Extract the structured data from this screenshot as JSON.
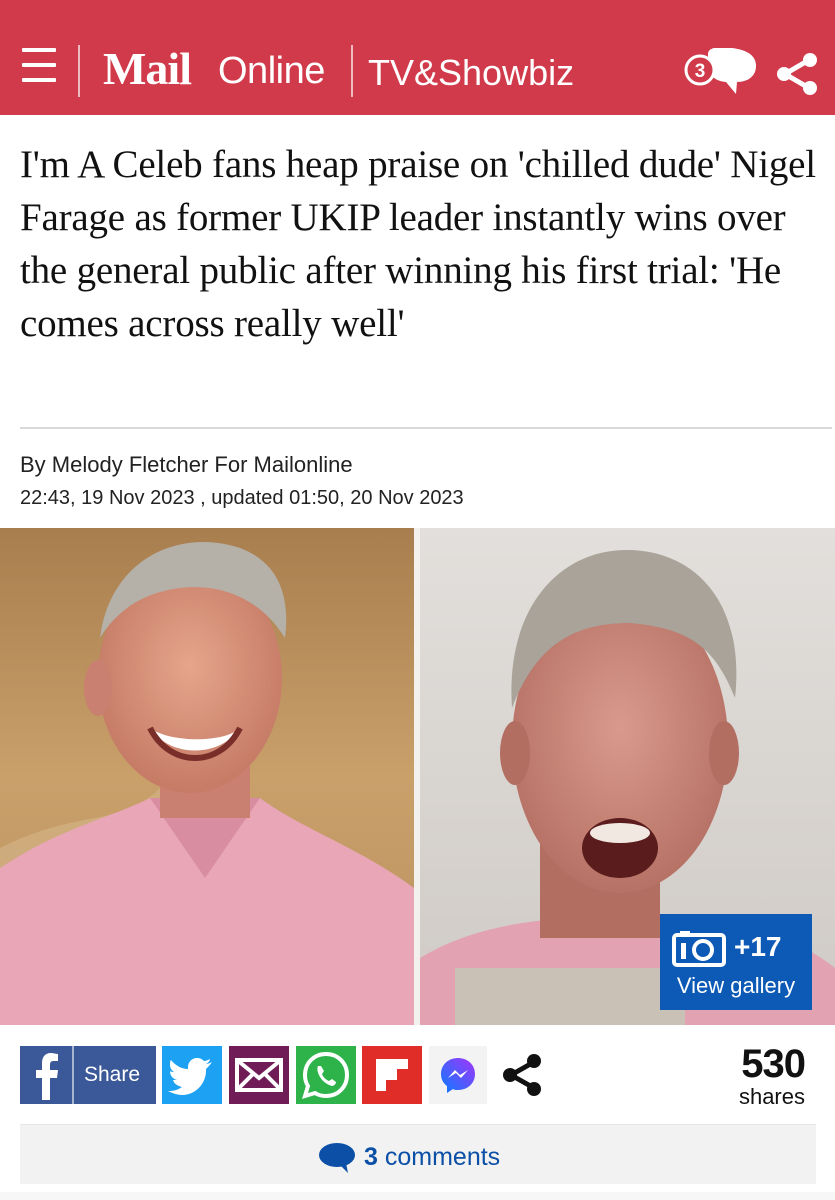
{
  "header": {
    "brand_mail": "Mail",
    "brand_online": "Online",
    "section": "TV&Showbiz",
    "comment_count": "3",
    "bg_color": "#d13a4a"
  },
  "article": {
    "headline": "I'm A Celeb fans heap praise on 'chilled dude' Nigel Farage as former UKIP leader instantly wins over the general public after winning his first trial: 'He comes across really well'",
    "byline": "By Melody Fletcher For Mailonline",
    "dateline": "22:43, 19 Nov 2023 , updated 01:50, 20 Nov 2023"
  },
  "gallery": {
    "count": "+17",
    "label": "View gallery",
    "bg_color": "#0c5ab5"
  },
  "share_bar": {
    "facebook_label": "Share",
    "share_count": "530",
    "share_count_label": "shares",
    "icons": [
      "facebook-icon",
      "twitter-icon",
      "email-icon",
      "whatsapp-icon",
      "flipboard-icon",
      "messenger-icon",
      "share-icon"
    ]
  },
  "comments": {
    "count": "3",
    "label": "comments"
  }
}
